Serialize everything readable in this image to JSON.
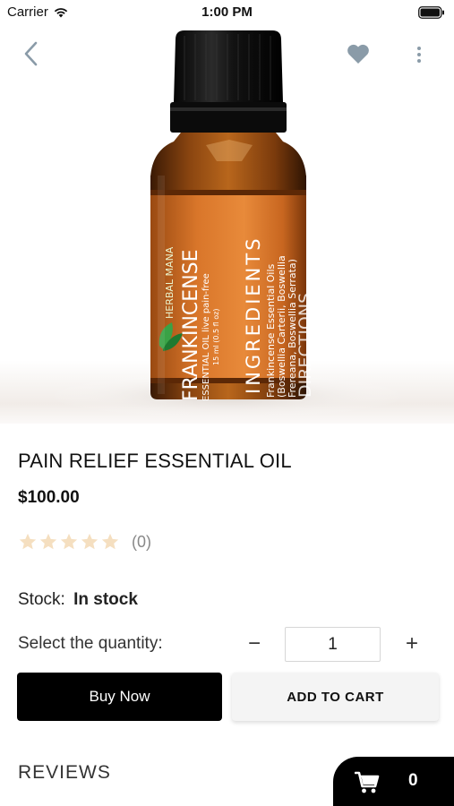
{
  "status_bar": {
    "carrier": "Carrier",
    "time": "1:00 PM",
    "icons": [
      "wifi-icon",
      "battery-icon"
    ]
  },
  "nav": {
    "icons": [
      "back-chevron-icon",
      "heart-icon",
      "more-vertical-icon"
    ],
    "accent_color": "#8a9ba8"
  },
  "product_image": {
    "brand_text": "HERBAL MANA",
    "name_text": "FRANKINCENSE",
    "sub_text": "ESSENTIAL OIL live pain-free",
    "size_text": "15 ml (0.5 fl oz)",
    "ingredients_heading": "INGREDIENTS",
    "ingredients_line1": "Frankincense Essential Oils",
    "ingredients_line2": "(Boswellia Carterii, Boswellia",
    "ingredients_line3": "Frereana, Boswellia Serrata)",
    "directions_text": "DIRECTIONS"
  },
  "product": {
    "title": "PAIN RELIEF ESSENTIAL OIL",
    "price": "$100.00",
    "rating": 0,
    "review_count": "(0)",
    "star_color": "#f5dfc0"
  },
  "stock": {
    "label": "Stock:",
    "value": "In stock"
  },
  "quantity": {
    "label": "Select the quantity:",
    "minus": "−",
    "value": "1",
    "plus": "+"
  },
  "actions": {
    "buy_now": "Buy Now",
    "add_to_cart": "ADD TO CART"
  },
  "reviews": {
    "heading": "REVIEWS"
  },
  "cart": {
    "count": "0"
  }
}
